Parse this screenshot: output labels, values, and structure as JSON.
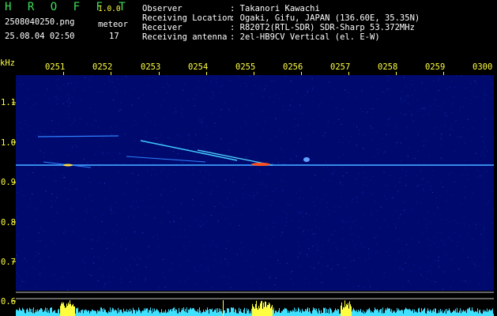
{
  "header": {
    "title": "H R O F F T",
    "version": "1.0.0",
    "filename": "2508040250.png",
    "datetime": "25.08.04 02:50",
    "meteor_label": "meteor",
    "meteor_count": "17"
  },
  "info": [
    {
      "key": "Observer",
      "value": ": Takanori Kawachi"
    },
    {
      "key": "Receiving Location",
      "value": ": Ogaki, Gifu, JAPAN (136.60E, 35.35N)"
    },
    {
      "key": "Receiver",
      "value": ": R820T2(RTL-SDR) SDR-Sharp 53.372MHz"
    },
    {
      "key": "Receiving antenna",
      "value": ": 2el-HB9CV Vertical (el. E-W)"
    }
  ],
  "axis": {
    "unit_label": "kHz",
    "x_ticks": [
      "0251",
      "0252",
      "0253",
      "0254",
      "0255",
      "0256",
      "0257",
      "0258",
      "0259",
      "0300"
    ],
    "y_ticks": [
      "1.1",
      "1.0",
      "0.9",
      "0.8",
      "0.7",
      "0.6"
    ]
  },
  "colors": {
    "background": "#000000",
    "plot_background": "#000a6e",
    "label_yellow": "#ffff40",
    "title_green": "#3de05a",
    "carrier_line": "#40c8ff",
    "bottom_bars": "#40e0ff",
    "spike_yellow": "#ffff40"
  }
}
